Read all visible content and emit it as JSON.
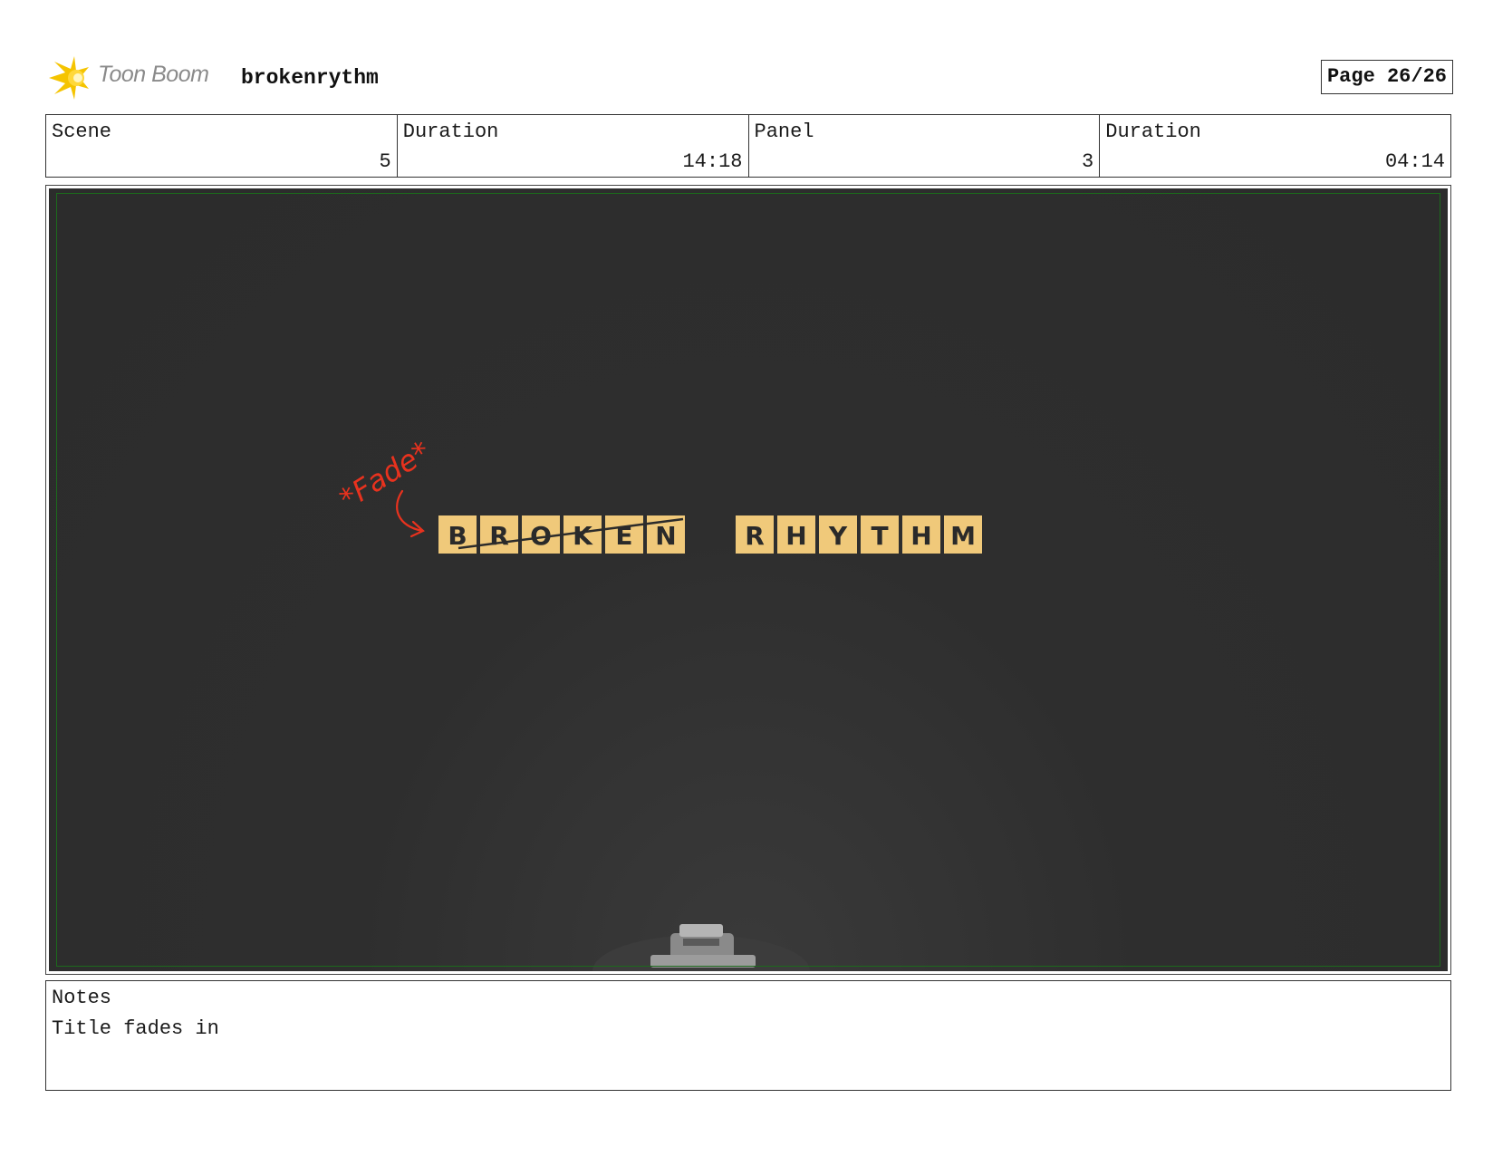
{
  "header": {
    "brand": "Toon Boom",
    "project": "brokenrythm",
    "page": "Page 26/26"
  },
  "info": [
    {
      "label": "Scene",
      "value": "5"
    },
    {
      "label": "Duration",
      "value": "14:18"
    },
    {
      "label": "Panel",
      "value": "3"
    },
    {
      "label": "Duration",
      "value": "04:14"
    }
  ],
  "panel": {
    "annotation": "*Fade*",
    "title_word1": [
      "B",
      "R",
      "O",
      "K",
      "E",
      "N"
    ],
    "title_word2": [
      "R",
      "H",
      "Y",
      "T",
      "H",
      "M"
    ],
    "tile_color": "#f0c97a",
    "annotation_color": "#e8321e",
    "background_color": "#2d2d2d"
  },
  "notes": {
    "label": "Notes",
    "text": "Title fades in"
  }
}
